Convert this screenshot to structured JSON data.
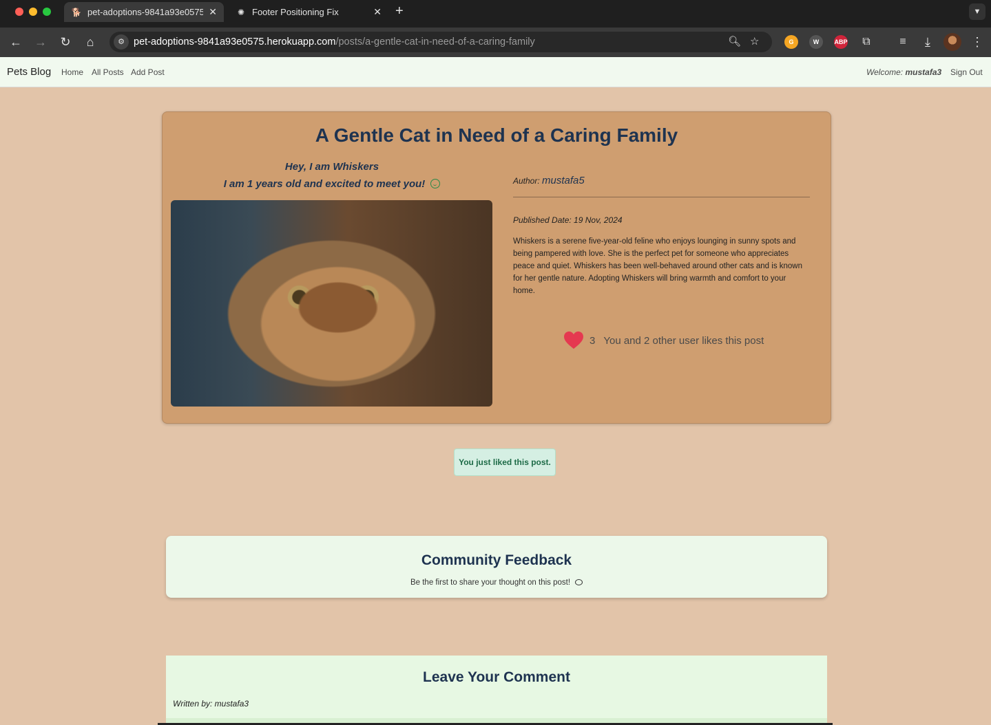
{
  "browser": {
    "tabs": [
      {
        "title": "pet-adoptions-9841a93e0575",
        "icon": "dog-icon",
        "active": true
      },
      {
        "title": "Footer Positioning Fix",
        "icon": "chatgpt-icon",
        "active": false
      }
    ],
    "url_host": "pet-adoptions-9841a93e0575.herokuapp.com",
    "url_path": "/posts/a-gentle-cat-in-need-of-a-caring-family",
    "extensions": [
      {
        "name": "g-extension",
        "label": "G",
        "color": "#f5a623"
      },
      {
        "name": "w-extension",
        "label": "W",
        "color": "#555555"
      },
      {
        "name": "abp-extension",
        "label": "ABP",
        "color": "#d0243a"
      }
    ]
  },
  "navbar": {
    "brand": "Pets Blog",
    "links": [
      "Home",
      "All Posts",
      "Add Post"
    ],
    "welcome_label": "Welcome:",
    "username": "mustafa3",
    "sign_out": "Sign Out"
  },
  "post": {
    "title": "A Gentle Cat in Need of a Caring Family",
    "greeting": "Hey, I am Whiskers",
    "age_line": "I am 1 years old and excited to meet you!",
    "author_label": "Author:",
    "author": "mustafa5",
    "published": "Published Date: 19 Nov, 2024",
    "description": "Whiskers is a serene five-year-old feline who enjoys lounging in sunny spots and being pampered with love. She is the perfect pet for someone who appreciates peace and quiet. Whiskers has been well-behaved around other cats and is known for her gentle nature. Adopting Whiskers will bring warmth and comfort to your home.",
    "like_count": "3",
    "like_text": "You and 2 other user likes this post",
    "heart_color": "#e53950"
  },
  "alert": "You just liked this post.",
  "feedback": {
    "title": "Community Feedback",
    "subtitle": "Be the first to share your thought on this post!"
  },
  "comment": {
    "title": "Leave Your Comment",
    "written_by": "Written by: mustafa3"
  }
}
